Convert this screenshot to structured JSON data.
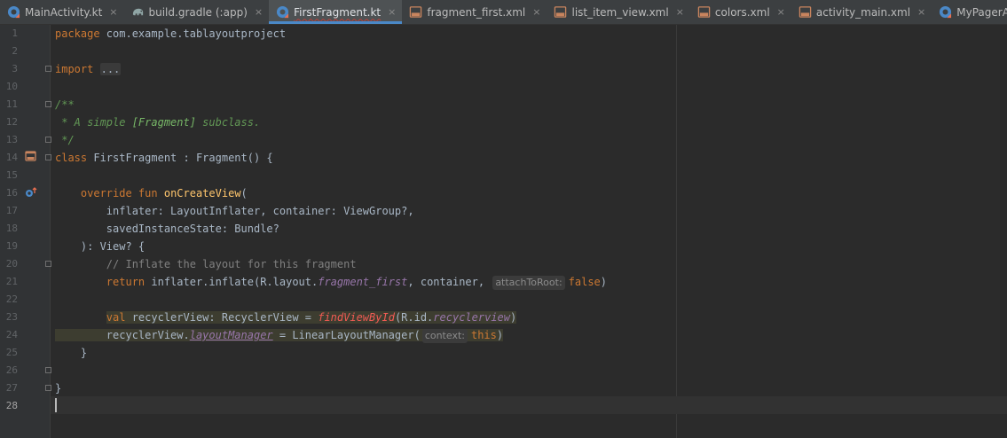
{
  "colors": {
    "background": "#2b2b2b",
    "tab_bar": "#3c3f41",
    "active_tab_indicator": "#4a88c7",
    "keyword": "#cc7832",
    "function": "#ffc66d",
    "comment": "#808080",
    "doc_comment": "#629755",
    "property": "#9876aa",
    "unresolved": "#f15b54"
  },
  "tabs": [
    {
      "label": "MainActivity.kt",
      "icon": "kotlin-file-icon",
      "active": false
    },
    {
      "label": "build.gradle (:app)",
      "icon": "gradle-elephant-icon",
      "active": false
    },
    {
      "label": "FirstFragment.kt",
      "icon": "kotlin-file-icon",
      "active": true
    },
    {
      "label": "fragment_first.xml",
      "icon": "xml-layout-icon",
      "active": false
    },
    {
      "label": "list_item_view.xml",
      "icon": "xml-layout-icon",
      "active": false
    },
    {
      "label": "colors.xml",
      "icon": "xml-layout-icon",
      "active": false
    },
    {
      "label": "activity_main.xml",
      "icon": "xml-layout-icon",
      "active": false
    },
    {
      "label": "MyPagerAdapter.kt",
      "icon": "kotlin-file-icon",
      "active": false
    }
  ],
  "tab_close_glyph": "×",
  "line_numbers": [
    "1",
    "2",
    "3",
    "10",
    "11",
    "12",
    "13",
    "14",
    "15",
    "16",
    "17",
    "18",
    "19",
    "20",
    "21",
    "22",
    "23",
    "24",
    "25",
    "26",
    "27",
    "28"
  ],
  "code": {
    "l1_kw": "package",
    "l1_rest": " com.example.tablayoutproject",
    "l3_kw": "import",
    "l3_fold": "...",
    "l11": "/**",
    "l12_a": " * A simple ",
    "l12_tag": "[Fragment]",
    "l12_b": " subclass.",
    "l13": " */",
    "l14_kw": "class",
    "l14_rest": " FirstFragment : Fragment() {",
    "l16_indent": "    ",
    "l16_kw": "override fun",
    "l16_sp": " ",
    "l16_fn": "onCreateView",
    "l16_paren": "(",
    "l17": "        inflater: LayoutInflater, container: ViewGroup?,",
    "l18": "        savedInstanceState: Bundle?",
    "l19": "    ): View? {",
    "l20": "        // Inflate the layout for this fragment",
    "l21_indent": "        ",
    "l21_kw": "return",
    "l21_a": " inflater.inflate(R.layout.",
    "l21_prop": "fragment_first",
    "l21_b": ", container, ",
    "l21_hint": "attachToRoot:",
    "l21_kw2": "false",
    "l21_c": ")",
    "l23_indent": "        ",
    "l23_kw": "val",
    "l23_a": " recyclerView: RecyclerView = ",
    "l23_err": "findViewById",
    "l23_b": "(R.id.",
    "l23_prop": "recyclerview",
    "l23_c": ")",
    "l24_a": "        recyclerView.",
    "l24_prop": "layoutManager",
    "l24_b": " = LinearLayoutManager(",
    "l24_hint": "context:",
    "l24_kw": "this",
    "l24_c": ")",
    "l25": "    }",
    "l27": "}"
  }
}
